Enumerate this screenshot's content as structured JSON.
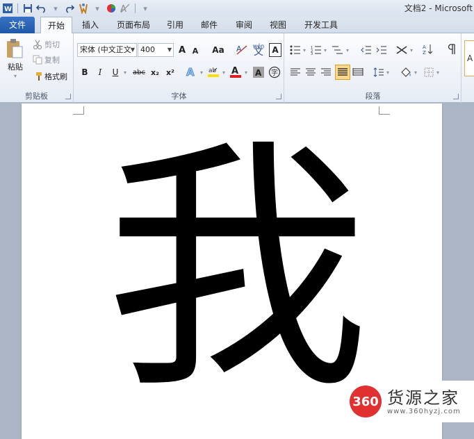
{
  "window": {
    "title": "文档2 - Microsoft"
  },
  "qat": {
    "icons": [
      "word-app-icon",
      "save-icon",
      "undo-icon",
      "redo-icon",
      "format-painter-icon",
      "color-icon",
      "clear-format-icon",
      "customize-icon"
    ]
  },
  "tabs": [
    "文件",
    "开始",
    "插入",
    "页面布局",
    "引用",
    "邮件",
    "审阅",
    "视图",
    "开发工具"
  ],
  "clipboard": {
    "paste": "粘贴",
    "cut": "剪切",
    "copy": "复制",
    "format_painter": "格式刷",
    "label": "剪贴板"
  },
  "font": {
    "name": "宋体 (中文正文",
    "size": "400",
    "grow": "A",
    "shrink": "A",
    "change_case": "Aa",
    "pinyin": "wén",
    "bold": "B",
    "italic": "I",
    "underline": "U",
    "strike": "abc",
    "subscript": "x₂",
    "superscript": "x²",
    "label": "字体"
  },
  "paragraph": {
    "label": "段落"
  },
  "document": {
    "content": "我"
  },
  "watermark": {
    "logo_text": "360",
    "name": "货源之家",
    "url": "www.360hyzj.com"
  },
  "colors": {
    "file_tab": "#2a64b5",
    "highlight": "#ffe000",
    "font_color": "#e02020",
    "active_button": "#ffd98a"
  }
}
